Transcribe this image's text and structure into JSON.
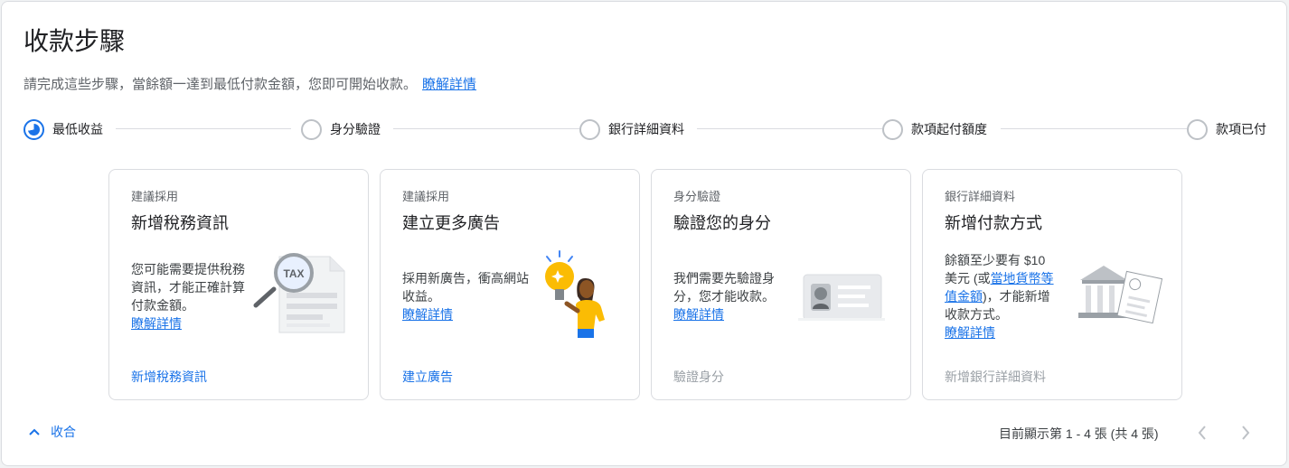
{
  "header": {
    "title": "收款步驟",
    "subtitle": "請完成這些步驟，當餘額一達到最低付款金額，您即可開始收款。",
    "learn_more": "瞭解詳情"
  },
  "steps": [
    {
      "label": "最低收益",
      "state": "active"
    },
    {
      "label": "身分驗證",
      "state": "pending"
    },
    {
      "label": "銀行詳細資料",
      "state": "pending"
    },
    {
      "label": "款項起付額度",
      "state": "pending"
    },
    {
      "label": "款項已付",
      "state": "pending"
    }
  ],
  "cards": [
    {
      "category": "建議採用",
      "title": "新增稅務資訊",
      "description": "您可能需要提供稅務資訊，才能正確計算付款金額。",
      "learn_more": "瞭解詳情",
      "action": "新增稅務資訊",
      "action_enabled": true,
      "illustration": "tax-document-magnifier",
      "tax_label": "TAX"
    },
    {
      "category": "建議採用",
      "title": "建立更多廣告",
      "description": "採用新廣告，衝高網站收益。",
      "learn_more": "瞭解詳情",
      "action": "建立廣告",
      "action_enabled": true,
      "illustration": "lightbulb-person"
    },
    {
      "category": "身分驗證",
      "title": "驗證您的身分",
      "description": "我們需要先驗證身分，您才能收款。",
      "learn_more": "瞭解詳情",
      "action": "驗證身分",
      "action_enabled": false,
      "illustration": "id-card"
    },
    {
      "category": "銀行詳細資料",
      "title": "新增付款方式",
      "description_before": "餘額至少要有 $10 美元 (或",
      "description_link": "當地貨幣等值金額",
      "description_after": ")，才能新增收款方式。",
      "learn_more": "瞭解詳情",
      "action": "新增銀行詳細資料",
      "action_enabled": false,
      "illustration": "bank-document"
    }
  ],
  "footer": {
    "collapse_label": "收合",
    "pager_text": "目前顯示第 1 - 4 張 (共 4 張)"
  },
  "colors": {
    "accent": "#1a73e8",
    "border": "#dadce0",
    "disabled": "#9aa0a6"
  }
}
